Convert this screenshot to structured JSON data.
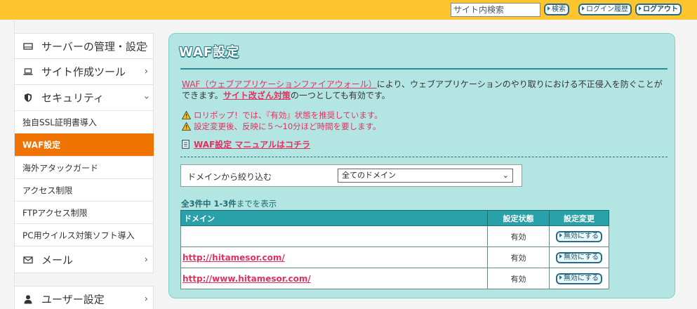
{
  "header": {
    "search_placeholder": "サイト内検索",
    "search_button": "検索",
    "login_history_button": "ログイン履歴",
    "logout_button": "ログアウト"
  },
  "sidebar": {
    "server": "サーバーの管理・設定",
    "site_tools": "サイト作成ツール",
    "security": "セキュリティ",
    "security_items": [
      "独自SSL証明書導入",
      "WAF設定",
      "海外アタックガード",
      "アクセス制限",
      "FTPアクセス制限",
      "PC用ウイルス対策ソフト導入"
    ],
    "mail": "メール",
    "user_settings": "ユーザー設定"
  },
  "main": {
    "title": "WAF設定",
    "intro_link1": "WAF（ウェブアプリケーションファイアウォール）",
    "intro_text1": "により、ウェブアプリケーションのやり取りにおける不正侵入を防ぐことができます。",
    "intro_link2": "サイト改ざん対策",
    "intro_text2": "の一つとしても有効です。",
    "warning1": "ロリポップ！では、『有効』状態を推奨しています。",
    "warning2": "設定変更後、反映に５～10分ほど時間を要します。",
    "manual_link": "WAF設定 マニュアルはコチラ",
    "filter_label": "ドメインから絞り込む",
    "filter_value": "全てのドメイン",
    "count_total": "全3件中 1-3件",
    "count_suffix": "までを表示",
    "table_headers": {
      "domain": "ドメイン",
      "status": "設定状態",
      "change": "設定変更"
    },
    "rows": [
      {
        "domain": "",
        "status": "有効",
        "action": "無効にする"
      },
      {
        "domain": "http://hitamesor.com/",
        "status": "有効",
        "action": "無効にする"
      },
      {
        "domain": "http://www.hitamesor.com/",
        "status": "有効",
        "action": "無効にする"
      }
    ]
  },
  "colors": {
    "topbar": "#ffc52e",
    "active_nav": "#f07200",
    "panel_bg": "#b3e6e3",
    "link": "#e0325f",
    "table_header": "#2aa0a8"
  }
}
